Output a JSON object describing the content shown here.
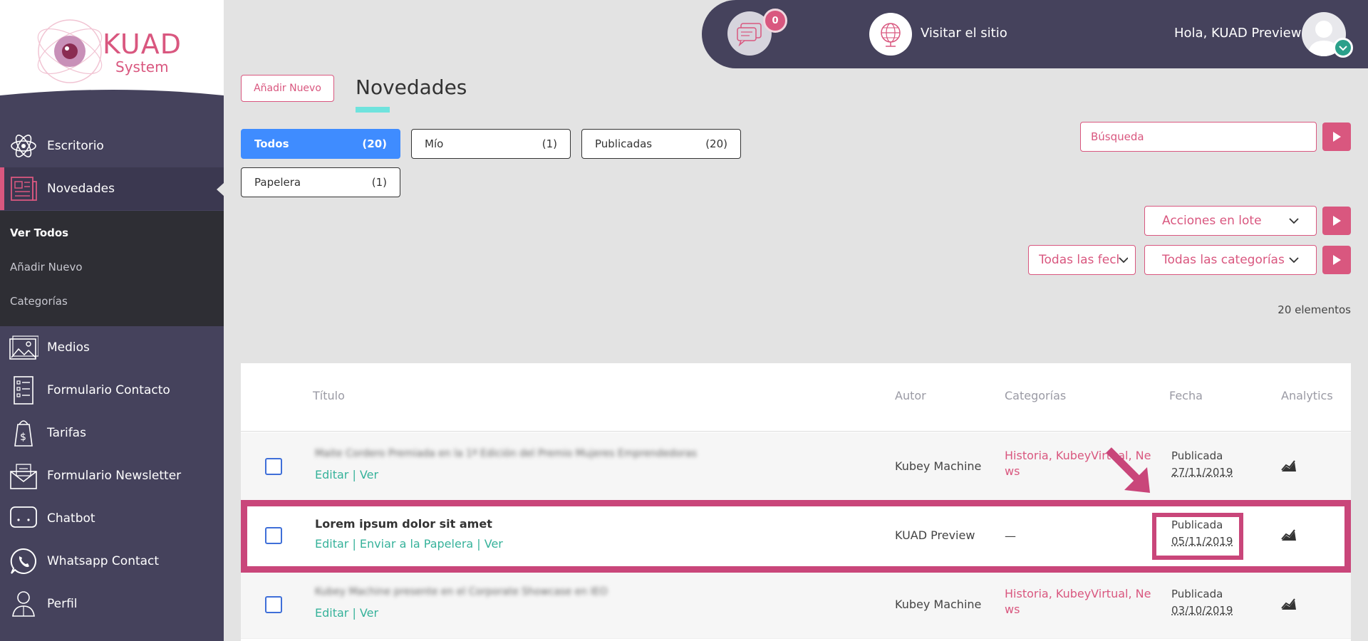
{
  "logo": {
    "line1": "KUAD",
    "line2": "System"
  },
  "header": {
    "notifications_count": "0",
    "visit_site": "Visitar el sitio",
    "greeting": "Hola, KUAD Preview"
  },
  "sidebar": {
    "items": [
      {
        "label": "Escritorio",
        "icon": "atom-icon"
      },
      {
        "label": "Novedades",
        "icon": "newspaper-icon"
      },
      {
        "label": "Medios",
        "icon": "image-icon"
      },
      {
        "label": "Formulario Contacto",
        "icon": "form-icon"
      },
      {
        "label": "Tarifas",
        "icon": "price-tag-icon"
      },
      {
        "label": "Formulario Newsletter",
        "icon": "newsletter-icon"
      },
      {
        "label": "Chatbot",
        "icon": "chat-icon"
      },
      {
        "label": "Whatsapp Contact",
        "icon": "whatsapp-icon"
      },
      {
        "label": "Perfil",
        "icon": "user-icon"
      }
    ],
    "submenu": [
      "Ver Todos",
      "Añadir Nuevo",
      "Categorías"
    ]
  },
  "main": {
    "add_new": "Añadir Nuevo",
    "title": "Novedades",
    "filters": [
      {
        "label": "Todos",
        "count": "(20)"
      },
      {
        "label": "Mío",
        "count": "(1)"
      },
      {
        "label": "Publicadas",
        "count": "(20)"
      },
      {
        "label": "Papelera",
        "count": "(1)"
      }
    ],
    "search_placeholder": "Búsqueda",
    "bulk_actions": "Acciones en lote",
    "all_dates": "Todas las fechas",
    "all_categories": "Todas las categorías",
    "items_count": "20 elementos"
  },
  "table": {
    "headers": [
      "Título",
      "Autor",
      "Categorías",
      "Fecha",
      "Analytics"
    ],
    "rows": [
      {
        "title": "Maite Cordero Premiada en la 1ª Edición del Premio Mujeres Emprendedoras",
        "actions": "Editar | Ver",
        "author": "Kubey Machine",
        "categories": "Historia, KubeyVirtual, News",
        "status": "Publicada",
        "date": "27/11/2019"
      },
      {
        "title": "Lorem ipsum dolor sit amet",
        "actions": "Editar | Enviar a la Papelera | Ver",
        "author": "KUAD Preview",
        "categories": "—",
        "status": "Publicada",
        "date": "05/11/2019"
      },
      {
        "title": "Kubey Machine presente en el Corporate Showcase en IEO",
        "actions": "Editar | Ver",
        "author": "Kubey Machine",
        "categories": "Historia, KubeyVirtual, News",
        "status": "Publicada",
        "date": "03/10/2019"
      }
    ]
  },
  "colors": {
    "sidebar": "#45425c",
    "accent": "#d9577f",
    "primary": "#3f8cff",
    "link": "#36b29a"
  }
}
